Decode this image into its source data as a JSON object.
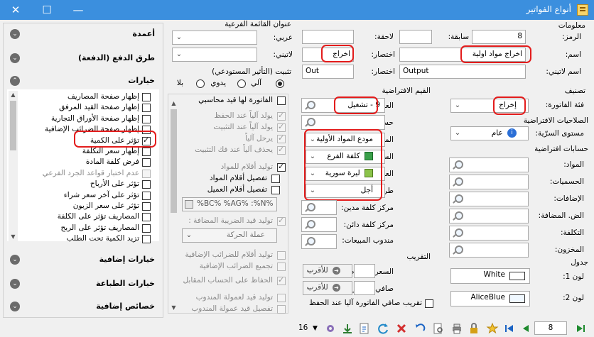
{
  "window": {
    "title": "أنواع الفواتير",
    "controls": {
      "close": "✕",
      "maximize": "☐",
      "minimize": "—"
    }
  },
  "info": {
    "title": "معلومات",
    "code_label": "الرمز:",
    "code_value": "8",
    "prev_label": "سابقة:",
    "prev_value": "",
    "next_label": "لاحقة:",
    "next_value": "",
    "name_label": "اسم:",
    "name_value": "اخراج مواد اولية",
    "abbr_label": "اختصار:",
    "abbr_value": "اخراج",
    "latin_name_label": "اسم لاتيني:",
    "latin_name_value": "Output",
    "latin_abbr_label": "اختصار:",
    "latin_abbr_value": "Out"
  },
  "classification": {
    "title": "تصنيف",
    "category_label": "فئة الفاتورة:",
    "category_value": "إخراج"
  },
  "permissions": {
    "title": "الصلاحيات الافتراضية",
    "level_label": "مستوى السرّية:",
    "level_value": "عام"
  },
  "default_accounts": {
    "title": "حسابات افتراضية",
    "items": [
      "المواد:",
      "الحسميات:",
      "الإضافات:",
      "الض. المضافة:",
      "التكلفة:",
      "المخزون:"
    ]
  },
  "table": {
    "title": "جدول",
    "color1_label": "لون 1:",
    "color1_value": "White",
    "color1_hex": "#ffffff",
    "color2_label": "لون 2:",
    "color2_value": "AliceBlue",
    "color2_hex": "#f0f8ff"
  },
  "defaults": {
    "title": "القيم الافتراضية",
    "customer_label": "العميل:",
    "customer_value": "9 - تشغيل",
    "cash_label": "حساب النقدي:",
    "warehouse_label": "المستودع:",
    "warehouse_value": "مودع المواد الأولية",
    "price_label": "السعر:",
    "price_value": "كلفة الفرع",
    "currency_label": "العملة:",
    "currency_value": "ليرة سورية",
    "payment_label": "طريقة الدفع:",
    "payment_value": "أجل",
    "cost_debit_label": "مركز كلفة مدين:",
    "cost_credit_label": "مركز كلفة دائن:",
    "sales_rep_label": "مندوب المبيعات:"
  },
  "rounding": {
    "title": "التقريب",
    "default_price_label": "السعر الافتراضي:",
    "default_price_value": "للأقرب",
    "net_label": "صافي الفاتورة:",
    "net_value": "للأقرب",
    "auto_round_label": "تقريب صافي الفاتورة آليا عند الحفظ"
  },
  "sub_menu": {
    "title": "عنوان القائمة الفرعية",
    "arabic_label": "عربي:",
    "latin_label": "لاتيني:"
  },
  "stock_effect": {
    "title": "تثبيت (التأثير المستودعي)",
    "options": [
      "آلي",
      "يدوي",
      "بلا"
    ],
    "selected": 0
  },
  "accounting": {
    "entry_label": "الفاتورة لها قيد محاسبي",
    "items": [
      "يولد آلياً عند الحفظ",
      "يولد آلياً عند التثبيت",
      "يرحل آلياً",
      "يحذف آلياً عند فك التثبيت",
      "توليد أقلام للمواد",
      "تفصيل أقلام المواد",
      "تفصيل أقلام العميل"
    ],
    "template_value": "%BC% %AG% :%N%",
    "vat_entry_label": "توليد قيد الضريبة المضافة :",
    "vat_combo_value": "عملة الحركة",
    "items2": [
      "توليد أقلام للضرائب الإضافية",
      "تجميع الضرائب الإضافية",
      "الحفاظ على الحساب المقابل",
      "توليد قيد لعمولة المندوب",
      "تفصيل قيد عمولة المندوب"
    ]
  },
  "sidebar": {
    "columns": "أعمدة",
    "payment_methods": "طرق الدفع (الدفعة)",
    "options_title": "خيارات",
    "options": [
      {
        "label": "إظهار صفحة المصاريف",
        "checked": false,
        "disabled": false
      },
      {
        "label": "إظهار صفحة القيد المرفق",
        "checked": false,
        "disabled": false
      },
      {
        "label": "إظهار صفحة الأوراق التجارية",
        "checked": false,
        "disabled": false
      },
      {
        "label": "إظهار صفحة الضرائب الإضافية",
        "checked": false,
        "disabled": false
      },
      {
        "label": "تؤثر على الكمية",
        "checked": true,
        "disabled": false
      },
      {
        "label": "إظهار سعر التكلفة",
        "checked": false,
        "disabled": false
      },
      {
        "label": "فرض كلفة المادة",
        "checked": false,
        "disabled": false
      },
      {
        "label": "عدم اختبار قواعد الجرد الفرعي",
        "checked": false,
        "disabled": true
      },
      {
        "label": "تؤثر على الأرباح",
        "checked": false,
        "disabled": false
      },
      {
        "label": "تؤثر على آخر سعر شراء",
        "checked": false,
        "disabled": false
      },
      {
        "label": "تؤثر على سعر الزبون",
        "checked": false,
        "disabled": false
      },
      {
        "label": "المصاريف تؤثر على الكلفة",
        "checked": false,
        "disabled": false
      },
      {
        "label": "المصاريف تؤثر على الربح",
        "checked": false,
        "disabled": false
      },
      {
        "label": "تزيد الكمية تحت الطلب",
        "checked": false,
        "disabled": false
      }
    ],
    "extra_options": "خيارات إضافية",
    "print_options": "خيارات الطباعة",
    "extra_props": "خصائص إضافية"
  },
  "toolbar": {
    "count": "16",
    "record": "8"
  }
}
